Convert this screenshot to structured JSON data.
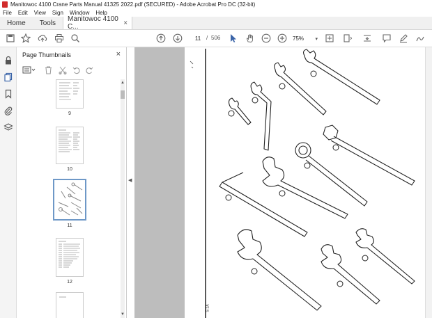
{
  "window": {
    "title": "Manitowoc 4100 Crane Parts Manual 41325 2022.pdf (SECURED) - Adobe Acrobat Pro DC (32-bit)"
  },
  "menu": [
    "File",
    "Edit",
    "View",
    "Sign",
    "Window",
    "Help"
  ],
  "tabs": {
    "home": "Home",
    "tools": "Tools",
    "doc": "Manitowoc 4100 C...",
    "close": "×"
  },
  "toolbar": {
    "page_current": "11",
    "page_sep": "/",
    "page_total": "506",
    "zoom": "75%"
  },
  "panel": {
    "title": "Page Thumbnails",
    "close": "×"
  },
  "thumbnails": [
    {
      "label": "9"
    },
    {
      "label": "10"
    },
    {
      "label": "11",
      "selected": true
    },
    {
      "label": "12"
    }
  ],
  "page": {
    "corner_mark": "S-1A"
  }
}
